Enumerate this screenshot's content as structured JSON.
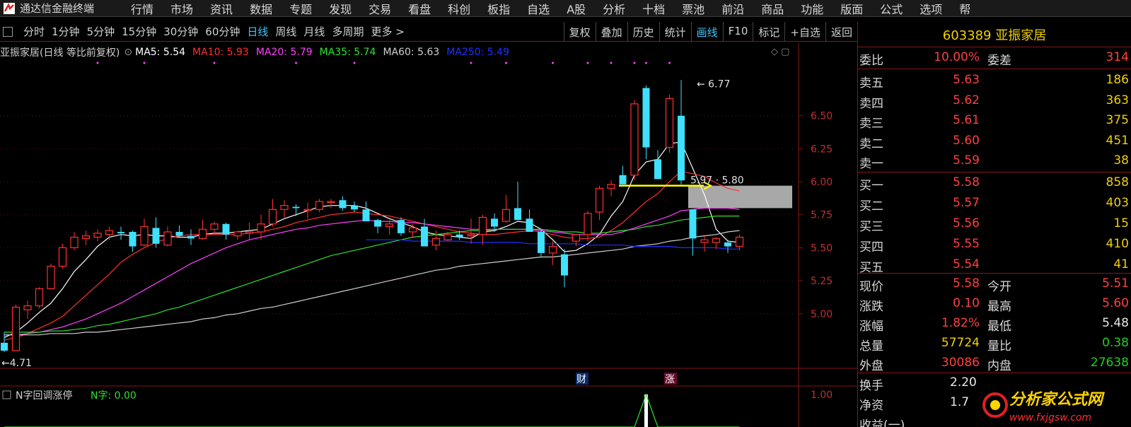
{
  "app": {
    "title": "通达信金融终端",
    "menu": [
      "行情",
      "市场",
      "资讯",
      "数据",
      "专题",
      "发现",
      "交易",
      "看盘",
      "科创",
      "板指",
      "自选",
      "A股",
      "分析",
      "十档",
      "票池",
      "前沿",
      "商品",
      "功能",
      "版面",
      "公式",
      "选项",
      "帮"
    ]
  },
  "toolbar": {
    "timeframes": [
      "分时",
      "1分钟",
      "5分钟",
      "15分钟",
      "30分钟",
      "60分钟",
      "日线",
      "周线",
      "月线",
      "多周期",
      "更多 >"
    ],
    "active_timeframe": "日线",
    "right_buttons": [
      "复权",
      "叠加",
      "历史",
      "统计",
      "画线",
      "F10",
      "标记",
      "+自选",
      "返回"
    ],
    "active_right": "画线"
  },
  "chart_header": {
    "stock": "亚振家居(日线 等比前复权)",
    "ma": [
      {
        "label": "MA5: 5.54",
        "color": "#ffffff"
      },
      {
        "label": "MA10: 5.93",
        "color": "#ff3030"
      },
      {
        "label": "MA20: 5.79",
        "color": "#ff40ff"
      },
      {
        "label": "MA35: 5.74",
        "color": "#30e030"
      },
      {
        "label": "MA60: 5.63",
        "color": "#d0d0d0"
      },
      {
        "label": "MA250: 5.49",
        "color": "#2030ff"
      }
    ]
  },
  "indicator": {
    "name": "N字回调涨停",
    "value_label": "N字: 0.00",
    "axis_label": "1.00"
  },
  "annotations": {
    "high": "6.77",
    "low": "4.71",
    "mid": "5.97 · 5.80",
    "marker_fin": "财",
    "marker_limit": "涨"
  },
  "chart_data": {
    "type": "candlestick",
    "ylim": [
      4.64,
      6.9
    ],
    "yticks": [
      "6.50",
      "6.25",
      "6.00",
      "5.75",
      "5.50",
      "5.25",
      "5.00"
    ],
    "candles": [
      {
        "o": 4.78,
        "h": 4.86,
        "l": 4.71,
        "c": 4.72
      },
      {
        "o": 4.72,
        "h": 5.07,
        "l": 4.72,
        "c": 5.05
      },
      {
        "o": 5.03,
        "h": 5.1,
        "l": 4.96,
        "c": 5.06
      },
      {
        "o": 5.06,
        "h": 5.2,
        "l": 5.04,
        "c": 5.19
      },
      {
        "o": 5.19,
        "h": 5.38,
        "l": 5.18,
        "c": 5.36
      },
      {
        "o": 5.36,
        "h": 5.53,
        "l": 5.34,
        "c": 5.5
      },
      {
        "o": 5.5,
        "h": 5.62,
        "l": 5.48,
        "c": 5.58
      },
      {
        "o": 5.57,
        "h": 5.63,
        "l": 5.52,
        "c": 5.59
      },
      {
        "o": 5.58,
        "h": 5.64,
        "l": 5.55,
        "c": 5.61
      },
      {
        "o": 5.6,
        "h": 5.66,
        "l": 5.56,
        "c": 5.63
      },
      {
        "o": 5.62,
        "h": 5.66,
        "l": 5.56,
        "c": 5.61
      },
      {
        "o": 5.62,
        "h": 5.63,
        "l": 5.47,
        "c": 5.51
      },
      {
        "o": 5.52,
        "h": 5.72,
        "l": 5.51,
        "c": 5.66
      },
      {
        "o": 5.65,
        "h": 5.73,
        "l": 5.5,
        "c": 5.53
      },
      {
        "o": 5.52,
        "h": 5.66,
        "l": 5.51,
        "c": 5.62
      },
      {
        "o": 5.62,
        "h": 5.67,
        "l": 5.58,
        "c": 5.59
      },
      {
        "o": 5.59,
        "h": 5.64,
        "l": 5.52,
        "c": 5.57
      },
      {
        "o": 5.57,
        "h": 5.71,
        "l": 5.56,
        "c": 5.64
      },
      {
        "o": 5.64,
        "h": 5.7,
        "l": 5.6,
        "c": 5.68
      },
      {
        "o": 5.68,
        "h": 5.69,
        "l": 5.56,
        "c": 5.6
      },
      {
        "o": 5.59,
        "h": 5.63,
        "l": 5.56,
        "c": 5.62
      },
      {
        "o": 5.61,
        "h": 5.69,
        "l": 5.56,
        "c": 5.62
      },
      {
        "o": 5.62,
        "h": 5.75,
        "l": 5.56,
        "c": 5.68
      },
      {
        "o": 5.68,
        "h": 5.87,
        "l": 5.66,
        "c": 5.79
      },
      {
        "o": 5.79,
        "h": 5.86,
        "l": 5.73,
        "c": 5.82
      },
      {
        "o": 5.81,
        "h": 5.83,
        "l": 5.74,
        "c": 5.8
      },
      {
        "o": 5.79,
        "h": 5.84,
        "l": 5.72,
        "c": 5.79
      },
      {
        "o": 5.79,
        "h": 5.87,
        "l": 5.77,
        "c": 5.85
      },
      {
        "o": 5.85,
        "h": 5.87,
        "l": 5.8,
        "c": 5.85
      },
      {
        "o": 5.86,
        "h": 5.89,
        "l": 5.78,
        "c": 5.8
      },
      {
        "o": 5.82,
        "h": 5.85,
        "l": 5.77,
        "c": 5.79
      },
      {
        "o": 5.79,
        "h": 5.85,
        "l": 5.72,
        "c": 5.7
      },
      {
        "o": 5.71,
        "h": 5.72,
        "l": 5.61,
        "c": 5.66
      },
      {
        "o": 5.66,
        "h": 5.71,
        "l": 5.6,
        "c": 5.68
      },
      {
        "o": 5.71,
        "h": 5.73,
        "l": 5.59,
        "c": 5.61
      },
      {
        "o": 5.62,
        "h": 5.68,
        "l": 5.58,
        "c": 5.65
      },
      {
        "o": 5.66,
        "h": 5.72,
        "l": 5.51,
        "c": 5.51
      },
      {
        "o": 5.52,
        "h": 5.63,
        "l": 5.48,
        "c": 5.57
      },
      {
        "o": 5.56,
        "h": 5.62,
        "l": 5.55,
        "c": 5.6
      },
      {
        "o": 5.6,
        "h": 5.63,
        "l": 5.56,
        "c": 5.58
      },
      {
        "o": 5.59,
        "h": 5.72,
        "l": 5.53,
        "c": 5.6
      },
      {
        "o": 5.6,
        "h": 5.75,
        "l": 5.52,
        "c": 5.73
      },
      {
        "o": 5.72,
        "h": 5.76,
        "l": 5.62,
        "c": 5.66
      },
      {
        "o": 5.7,
        "h": 5.9,
        "l": 5.69,
        "c": 5.79
      },
      {
        "o": 5.8,
        "h": 6.0,
        "l": 5.71,
        "c": 5.71
      },
      {
        "o": 5.72,
        "h": 5.79,
        "l": 5.64,
        "c": 5.62
      },
      {
        "o": 5.62,
        "h": 5.64,
        "l": 5.43,
        "c": 5.46
      },
      {
        "o": 5.46,
        "h": 5.55,
        "l": 5.37,
        "c": 5.51
      },
      {
        "o": 5.45,
        "h": 5.49,
        "l": 5.2,
        "c": 5.29
      },
      {
        "o": 5.55,
        "h": 5.6,
        "l": 5.51,
        "c": 5.6
      },
      {
        "o": 5.6,
        "h": 5.78,
        "l": 5.55,
        "c": 5.76
      },
      {
        "o": 5.77,
        "h": 5.97,
        "l": 5.71,
        "c": 5.95
      },
      {
        "o": 5.95,
        "h": 6.01,
        "l": 5.89,
        "c": 5.98
      },
      {
        "o": 6.05,
        "h": 6.12,
        "l": 5.98,
        "c": 5.98
      },
      {
        "o": 6.05,
        "h": 6.62,
        "l": 6.01,
        "c": 6.59
      },
      {
        "o": 6.71,
        "h": 6.73,
        "l": 6.17,
        "c": 6.26
      },
      {
        "o": 6.17,
        "h": 6.24,
        "l": 6.02,
        "c": 6.02
      },
      {
        "o": 6.26,
        "h": 6.66,
        "l": 6.22,
        "c": 6.63
      },
      {
        "o": 6.5,
        "h": 6.77,
        "l": 5.98,
        "c": 6.01
      },
      {
        "o": 5.79,
        "h": 5.79,
        "l": 5.44,
        "c": 5.57
      },
      {
        "o": 5.54,
        "h": 5.59,
        "l": 5.47,
        "c": 5.56
      },
      {
        "o": 5.54,
        "h": 5.58,
        "l": 5.49,
        "c": 5.57
      },
      {
        "o": 5.54,
        "h": 5.56,
        "l": 5.46,
        "c": 5.51
      },
      {
        "o": 5.51,
        "h": 5.6,
        "l": 5.48,
        "c": 5.58
      }
    ],
    "ma_series": [
      {
        "name": "MA5",
        "color": "#ffffff",
        "values": [
          4.82,
          4.86,
          4.93,
          5.01,
          5.08,
          5.19,
          5.32,
          5.41,
          5.51,
          5.58,
          5.6,
          5.59,
          5.6,
          5.59,
          5.59,
          5.58,
          5.58,
          5.6,
          5.61,
          5.61,
          5.62,
          5.63,
          5.64,
          5.68,
          5.72,
          5.75,
          5.78,
          5.81,
          5.82,
          5.82,
          5.82,
          5.8,
          5.76,
          5.72,
          5.69,
          5.66,
          5.62,
          5.6,
          5.59,
          5.58,
          5.57,
          5.62,
          5.63,
          5.66,
          5.7,
          5.69,
          5.64,
          5.56,
          5.47,
          5.48,
          5.53,
          5.6,
          5.74,
          5.85,
          6.05,
          6.15,
          6.17,
          6.29,
          6.3,
          6.1,
          5.9,
          5.64,
          5.55,
          5.54
        ]
      },
      {
        "name": "MA10",
        "color": "#ff3030",
        "values": [
          4.8,
          4.82,
          4.85,
          4.89,
          4.93,
          4.98,
          5.06,
          5.14,
          5.22,
          5.3,
          5.39,
          5.45,
          5.5,
          5.54,
          5.57,
          5.59,
          5.6,
          5.6,
          5.6,
          5.6,
          5.6,
          5.61,
          5.62,
          5.64,
          5.66,
          5.69,
          5.71,
          5.73,
          5.75,
          5.76,
          5.77,
          5.76,
          5.75,
          5.74,
          5.72,
          5.7,
          5.68,
          5.66,
          5.64,
          5.62,
          5.61,
          5.6,
          5.6,
          5.61,
          5.62,
          5.63,
          5.62,
          5.6,
          5.58,
          5.57,
          5.57,
          5.58,
          5.63,
          5.69,
          5.77,
          5.85,
          5.91,
          6.0,
          6.08,
          6.06,
          6.04,
          5.99,
          5.95,
          5.93
        ]
      },
      {
        "name": "MA20",
        "color": "#ff40ff",
        "values": [
          4.84,
          4.84,
          4.85,
          4.86,
          4.88,
          4.9,
          4.93,
          4.96,
          5.0,
          5.04,
          5.08,
          5.13,
          5.18,
          5.23,
          5.28,
          5.33,
          5.38,
          5.42,
          5.46,
          5.5,
          5.53,
          5.56,
          5.58,
          5.6,
          5.62,
          5.64,
          5.65,
          5.67,
          5.68,
          5.69,
          5.7,
          5.71,
          5.7,
          5.7,
          5.69,
          5.69,
          5.68,
          5.67,
          5.66,
          5.65,
          5.64,
          5.64,
          5.64,
          5.64,
          5.64,
          5.64,
          5.63,
          5.62,
          5.61,
          5.6,
          5.6,
          5.6,
          5.6,
          5.62,
          5.65,
          5.68,
          5.71,
          5.74,
          5.78,
          5.79,
          5.8,
          5.8,
          5.8,
          5.79
        ]
      },
      {
        "name": "MA35",
        "color": "#30e030",
        "values": [
          4.86,
          4.86,
          4.86,
          4.86,
          4.87,
          4.87,
          4.88,
          4.89,
          4.91,
          4.92,
          4.94,
          4.96,
          4.98,
          5.0,
          5.03,
          5.05,
          5.08,
          5.11,
          5.14,
          5.17,
          5.2,
          5.23,
          5.26,
          5.29,
          5.32,
          5.35,
          5.38,
          5.41,
          5.44,
          5.46,
          5.48,
          5.5,
          5.52,
          5.54,
          5.56,
          5.58,
          5.59,
          5.6,
          5.61,
          5.62,
          5.63,
          5.63,
          5.64,
          5.64,
          5.64,
          5.64,
          5.64,
          5.63,
          5.62,
          5.62,
          5.61,
          5.61,
          5.62,
          5.63,
          5.64,
          5.66,
          5.67,
          5.69,
          5.71,
          5.72,
          5.73,
          5.74,
          5.74,
          5.74
        ]
      },
      {
        "name": "MA60",
        "color": "#d0d0d0",
        "values": [
          4.84,
          4.84,
          4.84,
          4.84,
          4.85,
          4.85,
          4.85,
          4.86,
          4.86,
          4.87,
          4.88,
          4.89,
          4.9,
          4.91,
          4.92,
          4.93,
          4.94,
          4.96,
          4.97,
          4.99,
          5.0,
          5.02,
          5.04,
          5.05,
          5.07,
          5.09,
          5.11,
          5.13,
          5.15,
          5.17,
          5.19,
          5.21,
          5.23,
          5.25,
          5.27,
          5.29,
          5.31,
          5.33,
          5.34,
          5.36,
          5.37,
          5.38,
          5.39,
          5.4,
          5.41,
          5.42,
          5.43,
          5.43,
          5.44,
          5.45,
          5.46,
          5.47,
          5.48,
          5.49,
          5.51,
          5.52,
          5.53,
          5.55,
          5.56,
          5.58,
          5.59,
          5.6,
          5.62,
          5.63
        ]
      },
      {
        "name": "MA250",
        "color": "#2030ff",
        "values": [
          null,
          null,
          null,
          null,
          null,
          null,
          null,
          null,
          null,
          null,
          null,
          null,
          null,
          null,
          null,
          null,
          null,
          null,
          null,
          null,
          null,
          null,
          null,
          null,
          null,
          null,
          null,
          null,
          null,
          null,
          null,
          5.56,
          5.56,
          5.56,
          5.56,
          5.55,
          5.55,
          5.55,
          5.55,
          5.55,
          5.54,
          5.54,
          5.54,
          5.54,
          5.54,
          5.53,
          5.53,
          5.53,
          5.53,
          5.53,
          5.52,
          5.52,
          5.52,
          5.52,
          5.51,
          5.51,
          5.51,
          5.51,
          5.5,
          5.5,
          5.5,
          5.5,
          5.49,
          5.49
        ]
      }
    ],
    "indicator_values": [
      0,
      0,
      0,
      0,
      0,
      0,
      0,
      0,
      0,
      0,
      0,
      0,
      0,
      0,
      0,
      0,
      0,
      0,
      0,
      0,
      0,
      0,
      0,
      0,
      0,
      0,
      0,
      0,
      0,
      0,
      0,
      0,
      0,
      0,
      0,
      0,
      0,
      0,
      0,
      0,
      0,
      0,
      0,
      0,
      0,
      0,
      0,
      0,
      0,
      0,
      0,
      0,
      0,
      0,
      0,
      1,
      0,
      0,
      0,
      0,
      0,
      0,
      0,
      0
    ]
  },
  "sidebar": {
    "code_name": "603389 亚振家居",
    "webi": {
      "label": "委比",
      "value": "10.00%",
      "label2": "委差",
      "value2": "314"
    },
    "sell": [
      {
        "label": "卖五",
        "price": "5.63",
        "vol": "186"
      },
      {
        "label": "卖四",
        "price": "5.62",
        "vol": "363"
      },
      {
        "label": "卖三",
        "price": "5.61",
        "vol": "375"
      },
      {
        "label": "卖二",
        "price": "5.60",
        "vol": "451"
      },
      {
        "label": "卖一",
        "price": "5.59",
        "vol": "38"
      }
    ],
    "buy": [
      {
        "label": "买一",
        "price": "5.58",
        "vol": "858"
      },
      {
        "label": "买二",
        "price": "5.57",
        "vol": "403"
      },
      {
        "label": "买三",
        "price": "5.56",
        "vol": "15"
      },
      {
        "label": "买四",
        "price": "5.55",
        "vol": "410"
      },
      {
        "label": "买五",
        "price": "5.54",
        "vol": "41"
      }
    ],
    "stats": [
      {
        "l1": "现价",
        "v1": "5.58",
        "c1": "red",
        "l2": "今开",
        "v2": "5.51",
        "c2": "red"
      },
      {
        "l1": "涨跌",
        "v1": "0.10",
        "c1": "red",
        "l2": "最高",
        "v2": "5.60",
        "c2": "red"
      },
      {
        "l1": "涨幅",
        "v1": "1.82%",
        "c1": "red",
        "l2": "最低",
        "v2": "5.48",
        "c2": "wht"
      },
      {
        "l1": "总量",
        "v1": "57724",
        "c1": "yel",
        "l2": "量比",
        "v2": "0.38",
        "c2": "grn"
      },
      {
        "l1": "外盘",
        "v1": "30086",
        "c1": "red",
        "l2": "内盘",
        "v2": "27638",
        "c2": "grn"
      }
    ],
    "extra": [
      {
        "l1": "换手",
        "v1": "2.20"
      },
      {
        "l1": "净资",
        "v1": "1.7"
      },
      {
        "l1": "收益(一)",
        "v1": ""
      }
    ]
  },
  "watermark": {
    "line1": "分析家公式网",
    "line2": "www.fxjgsw.com"
  }
}
